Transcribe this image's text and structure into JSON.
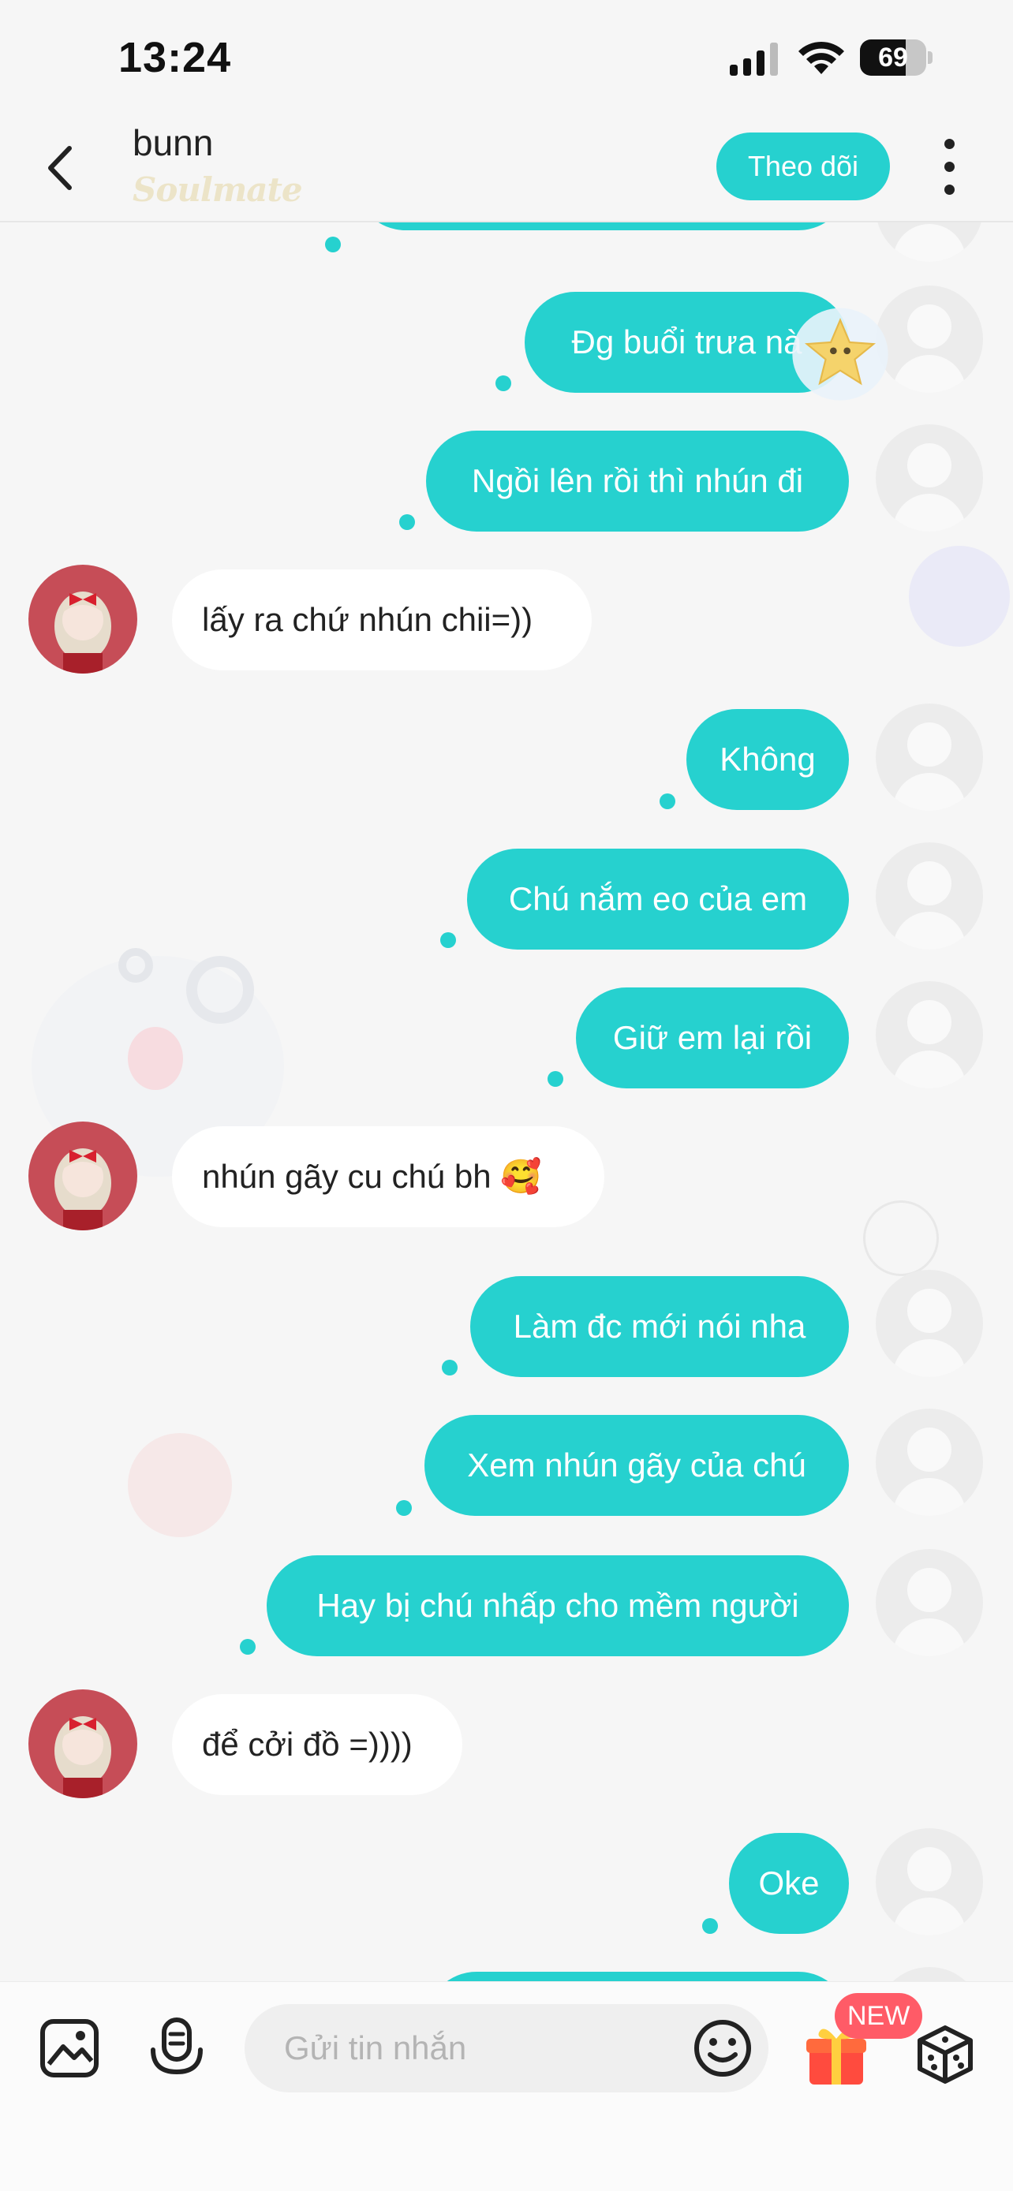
{
  "status_bar": {
    "time": "13:24",
    "battery": "69",
    "battery_level": 0.69
  },
  "header": {
    "name": "bunn",
    "tag": "Soulmate",
    "follow_label": "Theo dõi"
  },
  "messages": [
    {
      "from": "self",
      "text": "Đg buổi trưa nà"
    },
    {
      "from": "self",
      "text": "Ngồi lên rồi thì nhún đi"
    },
    {
      "from": "peer",
      "text": "lấy ra chứ nhún chii=))"
    },
    {
      "from": "self",
      "text": "Không"
    },
    {
      "from": "self",
      "text": "Chú nắm eo của em"
    },
    {
      "from": "self",
      "text": "Giữ em lại rồi"
    },
    {
      "from": "peer",
      "text": "nhún gãy cu chú bh 🥰"
    },
    {
      "from": "self",
      "text": "Làm đc mới nói nha"
    },
    {
      "from": "self",
      "text": "Xem nhún gãy của chú"
    },
    {
      "from": "self",
      "text": "Hay bị chú nhấp cho mềm người"
    },
    {
      "from": "peer",
      "text": "để cởi đồ =))))"
    },
    {
      "from": "self",
      "text": "Oke"
    }
  ],
  "composer": {
    "placeholder": "Gửi tin nhắn",
    "new_badge": "NEW"
  },
  "colors": {
    "accent": "#26d1cf",
    "peer_bubble": "#ffffff",
    "background": "#f6f6f6",
    "badge": "#ff5b67"
  }
}
